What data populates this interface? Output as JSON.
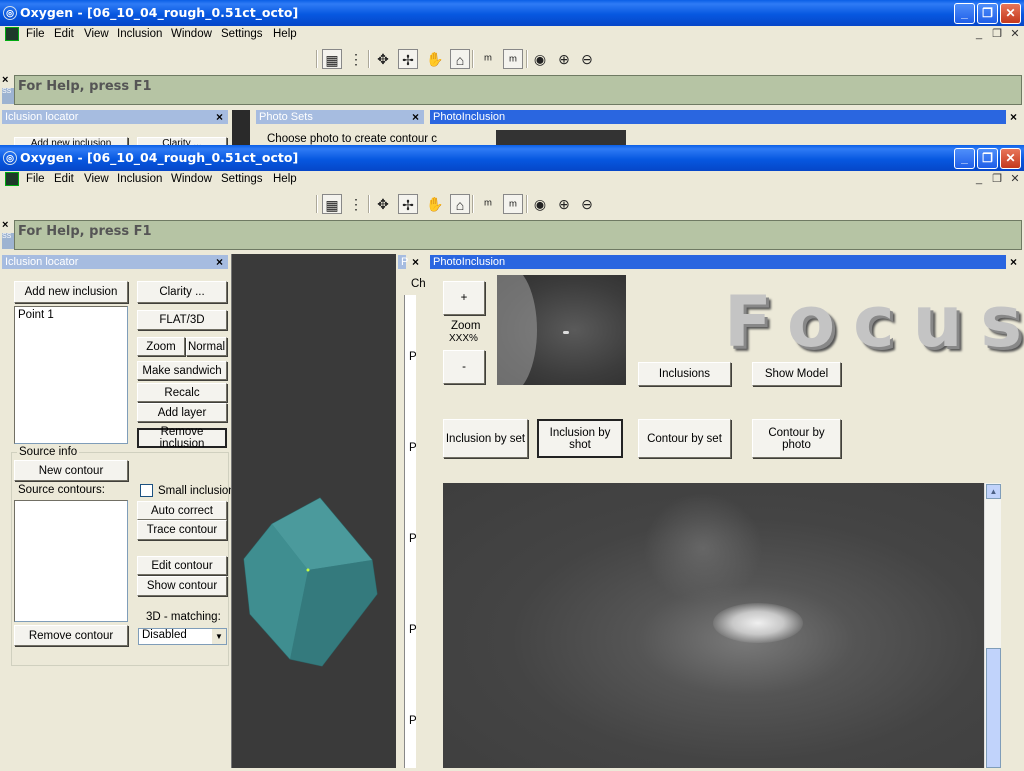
{
  "window": {
    "title": "Oxygen - [06_10_04_rough_0.51ct_octo]",
    "minimize": "_",
    "maximize": "❐",
    "close": "✕"
  },
  "menu": {
    "items": [
      "File",
      "Edit",
      "View",
      "Inclusion",
      "Window",
      "Settings",
      "Help"
    ],
    "mdi_min": "_",
    "mdi_restore": "❐",
    "mdi_close": "✕"
  },
  "helpbar": {
    "text": "For Help, press F1",
    "close": "×",
    "side_label": "SS"
  },
  "background_window": {
    "iclusion_locator_title": "Iclusion locator",
    "photo_sets_title": "Photo Sets",
    "photo_inclusion_title": "PhotoInclusion",
    "choose_photo_text": "Choose photo to create contour c",
    "add_new_inclusion_partial": "Add new inclusion",
    "clarity_partial": "Clarity ..."
  },
  "locator": {
    "title": "Iclusion locator",
    "add_new_inclusion": "Add new inclusion",
    "points": [
      "Point 1"
    ],
    "clarity": "Clarity ...",
    "flat3d": "FLAT/3D",
    "zoom": "Zoom",
    "normal": "Normal",
    "make_sandwich": "Make sandwich",
    "recalc": "Recalc",
    "add_layer": "Add layer",
    "remove_inclusion": "Remove inclusion",
    "source_info": "Source info",
    "new_contour": "New contour",
    "source_contours": "Source contours:",
    "small_inclusion": "Small inclusion",
    "auto_correct": "Auto correct",
    "trace_contour": "Trace contour",
    "edit_contour": "Edit contour",
    "show_contour": "Show contour",
    "matching_label": "3D - matching:",
    "matching_value": "Disabled",
    "remove_contour": "Remove contour"
  },
  "photo_sets": {
    "title": "P",
    "column_letter": "Ch",
    "row_letters": [
      "P",
      "P",
      "P",
      "P",
      "P"
    ]
  },
  "photo_inclusion": {
    "title": "PhotoInclusion",
    "zoom_plus": "+",
    "zoom_label": "Zoom",
    "zoom_value": "XXX%",
    "zoom_minus": "-",
    "inclusions": "Inclusions",
    "show_model": "Show Model",
    "inclusion_by_set": "Inclusion by set",
    "inclusion_by_shot": "Inclusion by shot",
    "contour_by_set": "Contour by set",
    "contour_by_photo": "Contour by photo",
    "focus_logo": "Focus"
  },
  "colors": {
    "titlebar": "#0758e0",
    "helpbar": "#b6c4a4",
    "gem": "#3d8a8c",
    "viewer_bg": "#3a3a3a"
  }
}
